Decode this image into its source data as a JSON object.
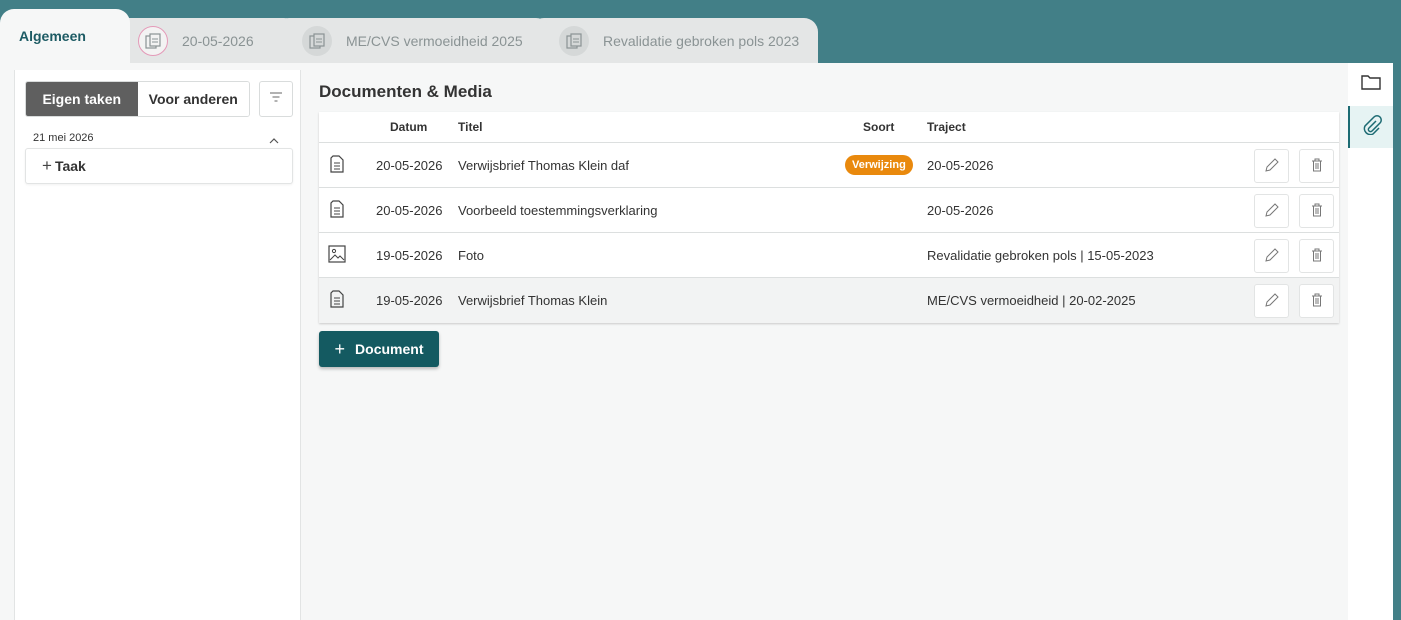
{
  "tabs": [
    {
      "label": "Algemeen",
      "active": true
    },
    {
      "label": "20-05-2026",
      "active": false,
      "icon": "document-stack-icon"
    },
    {
      "label": "ME/CVS vermoeidheid  2025",
      "active": false,
      "icon": "document-stack-icon"
    },
    {
      "label": "Revalidatie gebroken pols  2023",
      "active": false,
      "icon": "document-stack-icon"
    }
  ],
  "tasks": {
    "segments": [
      "Eigen taken",
      "Voor anderen"
    ],
    "selected": "Eigen taken",
    "date_label": "21 mei 2026",
    "add_task_label": "Taak"
  },
  "documents": {
    "title": "Documenten & Media",
    "columns": {
      "date": "Datum",
      "title": "Titel",
      "sort": "Soort",
      "traject": "Traject"
    },
    "rows": [
      {
        "icon": "document-icon",
        "date": "20-05-2026",
        "title": "Verwijsbrief Thomas Klein daf",
        "sort": "Verwijzing",
        "traject": "20-05-2026"
      },
      {
        "icon": "document-icon",
        "date": "20-05-2026",
        "title": "Voorbeeld toestemmingsverklaring",
        "sort": "",
        "traject": "20-05-2026"
      },
      {
        "icon": "image-icon",
        "date": "19-05-2026",
        "title": "Foto",
        "sort": "",
        "traject": "Revalidatie gebroken pols | 15-05-2023"
      },
      {
        "icon": "document-icon",
        "date": "19-05-2026",
        "title": "Verwijsbrief Thomas Klein",
        "sort": "",
        "traject": "ME/CVS vermoeidheid | 20-02-2025"
      }
    ],
    "add_button_label": "Document"
  },
  "colors": {
    "background": "#427f87",
    "primary": "#145a61",
    "badge": "#e9890d",
    "segment_active": "#5f5f5f"
  }
}
